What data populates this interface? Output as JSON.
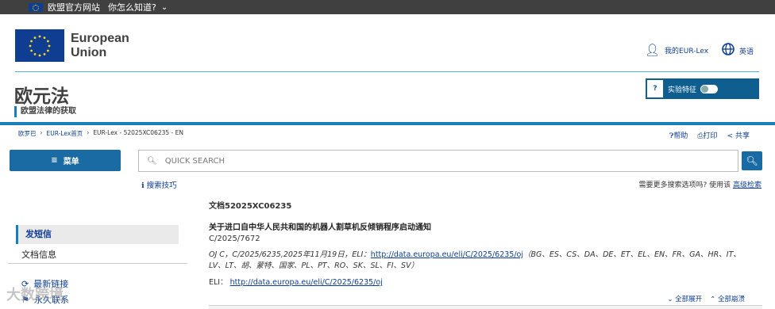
{
  "topbar": {
    "eu_site": "欧盟官方网站",
    "how_know": "你怎么知道?"
  },
  "header": {
    "logo_line1": "European",
    "logo_line2": "Union",
    "my_eurlex": "我的EUR-Lex",
    "language": "英语",
    "site_title": "欧元法",
    "site_subtitle": "欧盟法律的获取",
    "experimental_label": "实验特征",
    "experimental_help": "?"
  },
  "breadcrumb": {
    "home": "欧罗巴",
    "eurlex_home": "EUR-Lex首页",
    "current": "EUR-Lex - 52025XC06235 - EN"
  },
  "tools": {
    "help": "帮助",
    "print": "打印",
    "share": "共享"
  },
  "menu": {
    "label": "菜单"
  },
  "search": {
    "placeholder": "QUICK SEARCH",
    "tips": "搜索技巧",
    "more_text": "需要更多搜索选项吗? 使用该",
    "advanced": "高级检索"
  },
  "sidebar": {
    "active": "发短信",
    "doc_info": "文档信息",
    "latest_links": "最新链接",
    "permanent_link": "永久联系"
  },
  "document": {
    "number": "文档52025XC06235",
    "title": "关于进口自中华人民共和国的机器人割草机反倾销程序启动通知",
    "ref": "C/2025/7672",
    "oj_prefix": "OJ C，C/2025/6235,2025年11月19日，ELI：",
    "oj_link": "http://data.europa.eu/eli/C/2025/6235/oj",
    "oj_langs": "（BG、ES、CS、DA、DE、ET、EL、EN、FR、GA、HR、IT、LV、LT、胡、蒙特、国家、PL、PT、RO、SK、SL、FI、SV）",
    "eli_label": "ELI：",
    "eli_link": "http://data.europa.eu/eli/C/2025/6235/oj"
  },
  "expand": {
    "expand_all": "全部展开",
    "collapse_all": "全部崩溃"
  },
  "watermark": "大数跨境",
  "colors": {
    "eu_blue": "#0e3d91",
    "accent": "#1a7fb8",
    "button": "#1a6aa3"
  },
  "icons": [
    "eu-flag-icon",
    "chevron-down-icon",
    "person-icon",
    "globe-icon",
    "help-icon",
    "print-icon",
    "share-icon",
    "hamburger-icon",
    "search-icon",
    "info-icon",
    "link-icon",
    "bookmark-icon"
  ]
}
